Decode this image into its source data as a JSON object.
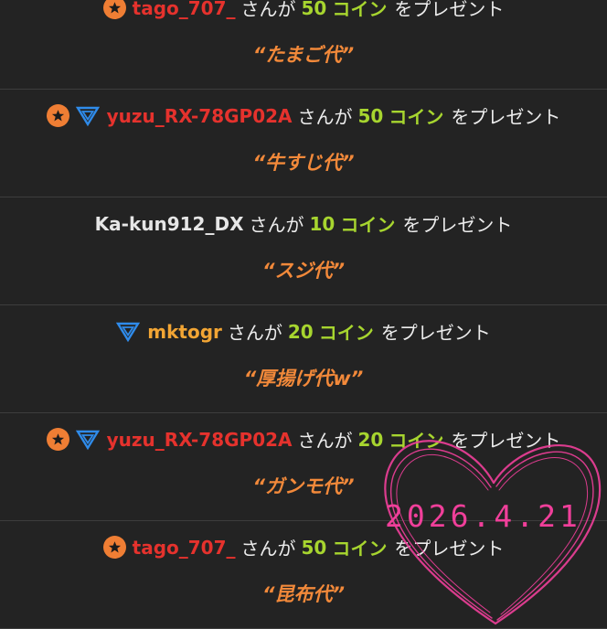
{
  "entries": [
    {
      "icons": [
        "star-badge"
      ],
      "name": "tago_707_",
      "name_color": "#e5322d",
      "suffix": "さんが",
      "amount": "50",
      "coin": "コイン",
      "action": "をプレゼント",
      "message": "“たまご代”"
    },
    {
      "icons": [
        "star-badge",
        "triangle-badge"
      ],
      "name": "yuzu_RX-78GP02A",
      "name_color": "#e5322d",
      "suffix": "さんが",
      "amount": "50",
      "coin": "コイン",
      "action": "をプレゼント",
      "message": "“牛すじ代”"
    },
    {
      "icons": [],
      "name": "Ka-kun912_DX",
      "name_color": "#e6e6e6",
      "suffix": "さんが",
      "amount": "10",
      "coin": "コイン",
      "action": "をプレゼント",
      "message": "“スジ代”"
    },
    {
      "icons": [
        "triangle-badge"
      ],
      "name": "mktogr",
      "name_color": "#f2a534",
      "suffix": "さんが",
      "amount": "20",
      "coin": "コイン",
      "action": "をプレゼント",
      "message": "“厚揚げ代w”"
    },
    {
      "icons": [
        "star-badge",
        "triangle-badge"
      ],
      "name": "yuzu_RX-78GP02A",
      "name_color": "#e5322d",
      "suffix": "さんが",
      "amount": "20",
      "coin": "コイン",
      "action": "をプレゼント",
      "message": "“ガンモ代”"
    },
    {
      "icons": [
        "star-badge"
      ],
      "name": "tago_707_",
      "name_color": "#e5322d",
      "suffix": "さんが",
      "amount": "50",
      "coin": "コイン",
      "action": "をプレゼント",
      "message": "“昆布代”"
    }
  ],
  "overlay": {
    "date": "2026.4.21",
    "color": "#f03f9a",
    "shape": "heart-doodle"
  },
  "colors": {
    "background": "#232323",
    "amount": "#a7d52f",
    "message": "#f2893a",
    "divider": "#3d3d3d"
  }
}
